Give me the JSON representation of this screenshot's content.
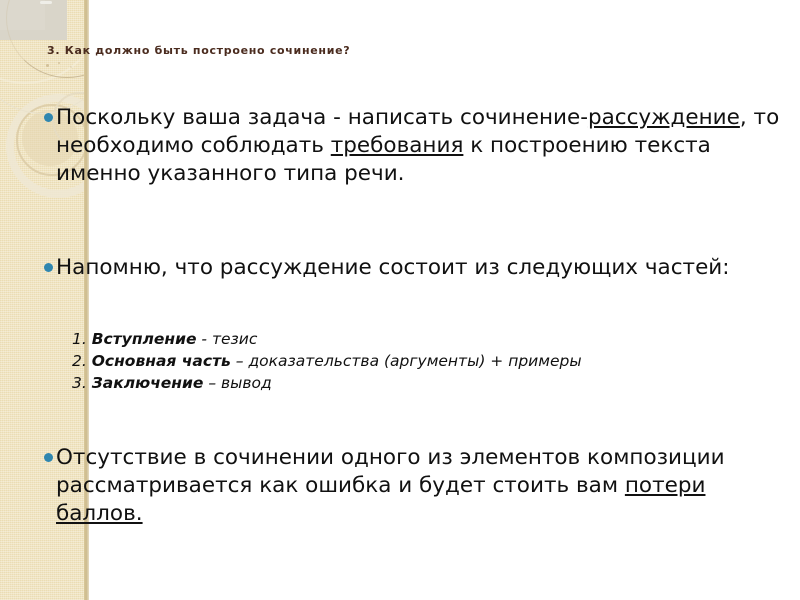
{
  "slide": {
    "title": "3. Как должно быть построено сочинение?",
    "title_color": "#4a2b1e",
    "background_color": "#ffffff",
    "band_color": "#f0e4c0",
    "bullet_color": "#2f86af"
  },
  "bullets": {
    "first": {
      "part1": "Поскольку ваша задача - написать сочинение-",
      "underline1": "рассуждение",
      "part2": ", то необходимо соблюдать ",
      "underline2": "требования",
      "part3": " к построению текста именно указанного типа речи."
    },
    "second": {
      "text": "Напомню, что рассуждение состоит из следующих частей:"
    },
    "third": {
      "part1": "Отсутствие в сочинении одного из элементов композиции рассматривается как ошибка и будет стоить вам ",
      "underline1": "потери баллов."
    }
  },
  "numbered_list": [
    {
      "index": "1.",
      "term": "Вступление",
      "dash": " - ",
      "desc": "тезис"
    },
    {
      "index": "2.",
      "term": "Основная часть",
      "dash": " – ",
      "desc": "доказательства (аргументы) + примеры"
    },
    {
      "index": "3.",
      "term": "Заключение",
      "dash": " – ",
      "desc": "вывод"
    }
  ]
}
